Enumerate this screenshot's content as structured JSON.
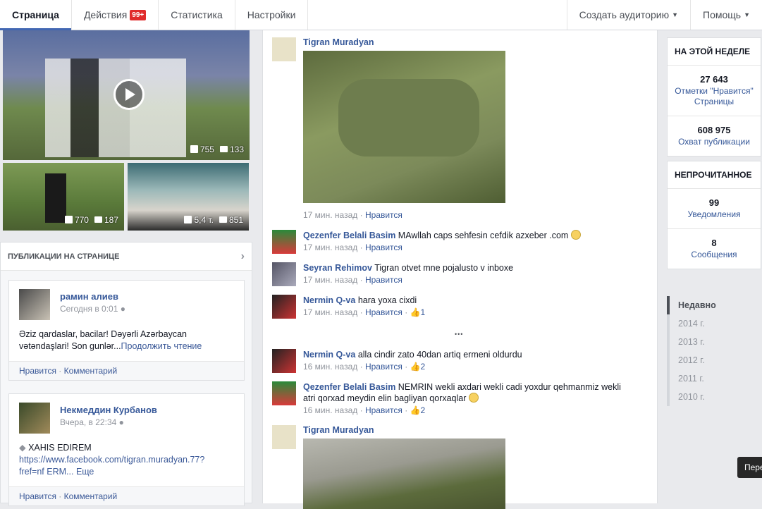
{
  "nav": {
    "tabs": [
      {
        "label": "Страница"
      },
      {
        "label": "Действия",
        "badge": "99+"
      },
      {
        "label": "Статистика"
      },
      {
        "label": "Настройки"
      }
    ],
    "right": [
      {
        "label": "Создать аудиторию"
      },
      {
        "label": "Помощь"
      }
    ]
  },
  "media": {
    "video": {
      "likes": "755",
      "comments": "133"
    },
    "thumb1": {
      "likes": "770",
      "comments": "187"
    },
    "thumb2": {
      "likes": "5,4 т.",
      "comments": "851"
    }
  },
  "left_panel": {
    "title": "ПУБЛИКАЦИИ НА СТРАНИЦЕ",
    "posts": [
      {
        "name": "рамин алиев",
        "time": "Сегодня в 0:01",
        "text1": "Əziz qardaslar, bacilar! Dəyərli Azərbaycan",
        "text2": "vətəndaşlari! Son gunlər...",
        "more": "Продолжить чтение",
        "like": "Нравится",
        "sep": " · ",
        "comment": "Комментарий"
      },
      {
        "name": "Некмеддин Курбанов",
        "time": "Вчера, в 22:34",
        "text1": "XAHIS EDIREM",
        "text2": "https://www.facebook.com/tigran.muradyan.77?",
        "text3": "fref=nf ERM...",
        "more": "Еще",
        "like": "Нравится",
        "sep": " · ",
        "comment": "Комментарий"
      }
    ]
  },
  "feed": {
    "items": [
      {
        "name": "Tigran Muradyan",
        "time": "17 мин. назад",
        "like": "Нравится",
        "sep": " · "
      },
      {
        "name": "Qezenfer Belali Basim",
        "text": "MAwllah caps sehfesin cefdik azxeber .com",
        "time": "17 мин. назад",
        "like": "Нравится",
        "sep": " · "
      },
      {
        "name": "Seyran Rehimov",
        "text": "Tigran otvet mne pojalusto v inboxe",
        "time": "17 мин. назад",
        "like": "Нравится",
        "sep": " · "
      },
      {
        "name": "Nermin Q-va",
        "text": "hara yoxa cixdi",
        "time": "17 мин. назад",
        "like": "Нравится",
        "sep": " · ",
        "count": "1"
      },
      {
        "name": "Nermin Q-va",
        "text": "alla cindir zato 40dan artiq ermeni oldurdu",
        "time": "16 мин. назад",
        "like": "Нравится",
        "sep": " · ",
        "count": "2"
      },
      {
        "name": "Qezenfer Belali Basim",
        "text": "NEMRIN wekli axdari wekli cadi yoxdur qehmanmiz wekli",
        "text2": "atri qorxad meydin elin bagliyan qorxaqlar",
        "time": "16 мин. назад",
        "like": "Нравится",
        "sep": " · ",
        "count": "2"
      },
      {
        "name": "Tigran Muradyan"
      }
    ],
    "ellipsis": "•••"
  },
  "right": {
    "week_title": "НА ЭТОЙ НЕДЕЛЕ",
    "likes_num": "27 643",
    "likes_lbl": "Отметки \"Нравится\" Страницы",
    "reach_num": "608 975",
    "reach_lbl": "Охват публикации",
    "unread_title": "НЕПРОЧИТАННОЕ",
    "notif_num": "99",
    "notif_lbl": "Уведомления",
    "msg_num": "8",
    "msg_lbl": "Сообщения"
  },
  "years": [
    "Недавно",
    "2014 г.",
    "2013 г.",
    "2012 г.",
    "2011 г.",
    "2010 г."
  ],
  "tooltip": "Пере"
}
